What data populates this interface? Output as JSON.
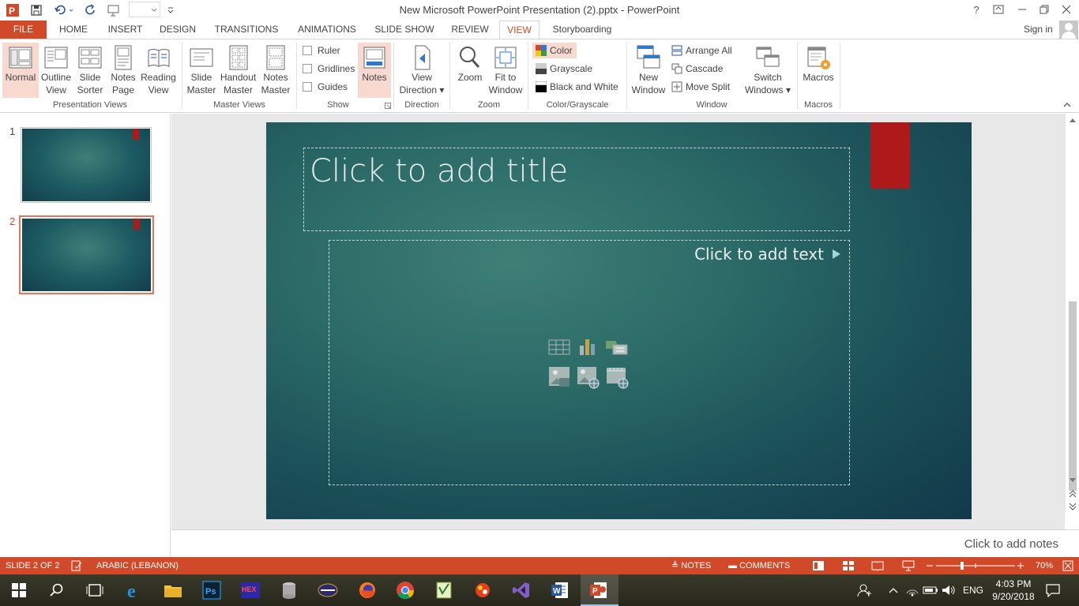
{
  "window": {
    "title": "New Microsoft PowerPoint Presentation (2).pptx - PowerPoint",
    "signin": "Sign in",
    "help": "?"
  },
  "tabs": [
    "FILE",
    "HOME",
    "INSERT",
    "DESIGN",
    "TRANSITIONS",
    "ANIMATIONS",
    "SLIDE SHOW",
    "REVIEW",
    "VIEW",
    "Storyboarding"
  ],
  "active_tab": "VIEW",
  "ribbon": {
    "presentation_views": {
      "label": "Presentation Views",
      "normal": "Normal",
      "outline": [
        "Outline",
        "View"
      ],
      "sorter": [
        "Slide",
        "Sorter"
      ],
      "notes_page": [
        "Notes",
        "Page"
      ],
      "reading": [
        "Reading",
        "View"
      ]
    },
    "master_views": {
      "label": "Master Views",
      "slide": [
        "Slide",
        "Master"
      ],
      "handout": [
        "Handout",
        "Master"
      ],
      "notes": [
        "Notes",
        "Master"
      ]
    },
    "show": {
      "label": "Show",
      "ruler": "Ruler",
      "gridlines": "Gridlines",
      "guides": "Guides",
      "notes": "Notes"
    },
    "direction": {
      "label": "Direction",
      "view_direction": [
        "View",
        "Direction"
      ]
    },
    "zoom": {
      "label": "Zoom",
      "zoom": "Zoom",
      "fit": [
        "Fit to",
        "Window"
      ]
    },
    "color": {
      "label": "Color/Grayscale",
      "color": "Color",
      "grayscale": "Grayscale",
      "bw": "Black and White"
    },
    "window": {
      "label": "Window",
      "new_window": [
        "New",
        "Window"
      ],
      "arrange_all": "Arrange All",
      "cascade": "Cascade",
      "move_split": "Move Split",
      "switch": [
        "Switch",
        "Windows"
      ]
    },
    "macros": {
      "label": "Macros",
      "macros": "Macros"
    }
  },
  "thumbnails": [
    {
      "number": "1",
      "selected": false
    },
    {
      "number": "2",
      "selected": true
    }
  ],
  "slide": {
    "title_placeholder": "Click to add title",
    "text_placeholder": "Click to add text"
  },
  "notes_placeholder": "Click to add notes",
  "status": {
    "slide": "SLIDE 2 OF 2",
    "language": "ARABIC (LEBANON)",
    "notes": "NOTES",
    "comments": "COMMENTS",
    "zoom": "70%"
  },
  "taskbar": {
    "language": "ENG",
    "time": "4:03 PM",
    "date": "9/20/2018",
    "apps": [
      "start",
      "search",
      "task-view",
      "edge",
      "file-explorer",
      "photoshop",
      "hex-editor",
      "storage",
      "media-player",
      "firefox",
      "chrome",
      "notepad",
      "paint",
      "visual-studio",
      "word",
      "powerpoint"
    ]
  },
  "colors": {
    "accent": "#d04a2a",
    "slide_bg": "#1b5159",
    "ribbon_mark": "#b01919"
  }
}
